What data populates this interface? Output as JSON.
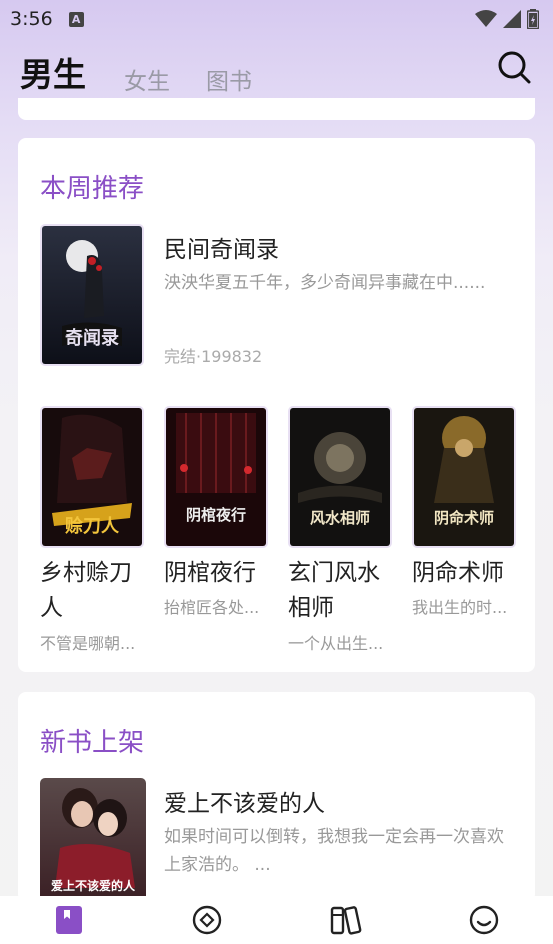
{
  "status": {
    "time": "3:56",
    "notification_icon": "A"
  },
  "tabs": [
    {
      "label": "男生",
      "active": true
    },
    {
      "label": "女生",
      "active": false
    },
    {
      "label": "图书",
      "active": false
    }
  ],
  "weekly": {
    "title": "本周推荐",
    "featured": {
      "title": "民间奇闻录",
      "desc": "泱泱华夏五千年，多少奇闻异事藏在中......",
      "meta": "完结·199832",
      "cover_text": "奇闻录"
    },
    "grid": [
      {
        "title": "乡村赊刀人",
        "desc": "不管是哪朝...",
        "cover_text": "赊刀人"
      },
      {
        "title": "阴棺夜行",
        "desc": "抬棺匠各处...",
        "cover_text": "阴棺夜行"
      },
      {
        "title": "玄门风水相师",
        "desc": "一个从出生...",
        "cover_text": "风水相师"
      },
      {
        "title": "阴命术师",
        "desc": "我出生的时...",
        "cover_text": "阴命术师"
      }
    ]
  },
  "new_books": {
    "title": "新书上架",
    "featured": {
      "title": "爱上不该爱的人",
      "desc_line1": "如果时间可以倒转，我想我一定会再一次喜欢",
      "desc_line2": "上家浩的。 ...",
      "cover_text": "爱上不该爱的人"
    }
  },
  "bottom_nav": [
    {
      "icon": "bookshelf-icon",
      "active": true
    },
    {
      "icon": "discover-icon",
      "active": false
    },
    {
      "icon": "library-icon",
      "active": false
    },
    {
      "icon": "profile-icon",
      "active": false
    }
  ],
  "colors": {
    "accent": "#8a4fc6",
    "tab_indicator": "#8a5bd1"
  }
}
